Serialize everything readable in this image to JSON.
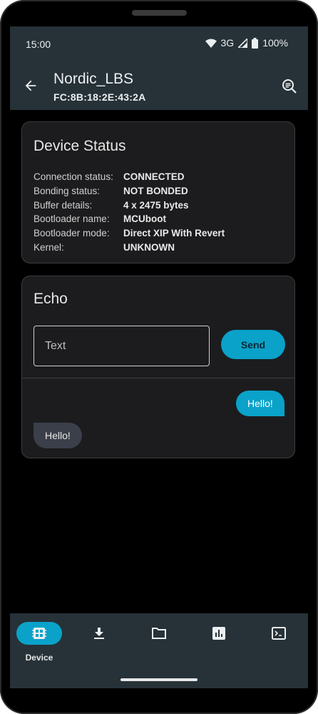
{
  "status_bar": {
    "time": "15:00",
    "network": "3G",
    "battery": "100%"
  },
  "app_bar": {
    "title": "Nordic_LBS",
    "subtitle": "FC:8B:18:2E:43:2A"
  },
  "device_status": {
    "title": "Device Status",
    "rows": [
      {
        "label": "Connection status:",
        "value": "CONNECTED"
      },
      {
        "label": "Bonding status:",
        "value": "NOT BONDED"
      },
      {
        "label": "Buffer details:",
        "value": "4 x 2475 bytes"
      },
      {
        "label": "Bootloader name:",
        "value": "MCUboot"
      },
      {
        "label": "Bootloader mode:",
        "value": "Direct XIP With Revert"
      },
      {
        "label": "Kernel:",
        "value": "UNKNOWN"
      }
    ]
  },
  "echo": {
    "title": "Echo",
    "input_placeholder": "Text",
    "send_label": "Send",
    "messages": [
      {
        "direction": "sent",
        "text": "Hello!"
      },
      {
        "direction": "received",
        "text": "Hello!"
      }
    ]
  },
  "bottom_nav": {
    "items": [
      {
        "icon": "device-icon",
        "label": "Device",
        "active": true
      },
      {
        "icon": "download-icon",
        "label": "",
        "active": false
      },
      {
        "icon": "folder-icon",
        "label": "",
        "active": false
      },
      {
        "icon": "chart-icon",
        "label": "",
        "active": false
      },
      {
        "icon": "terminal-icon",
        "label": "",
        "active": false
      }
    ]
  },
  "colors": {
    "accent": "#0aa2c9",
    "bar": "#263238",
    "card": "#1c1c1e",
    "received_bubble": "#3b3f4a"
  }
}
